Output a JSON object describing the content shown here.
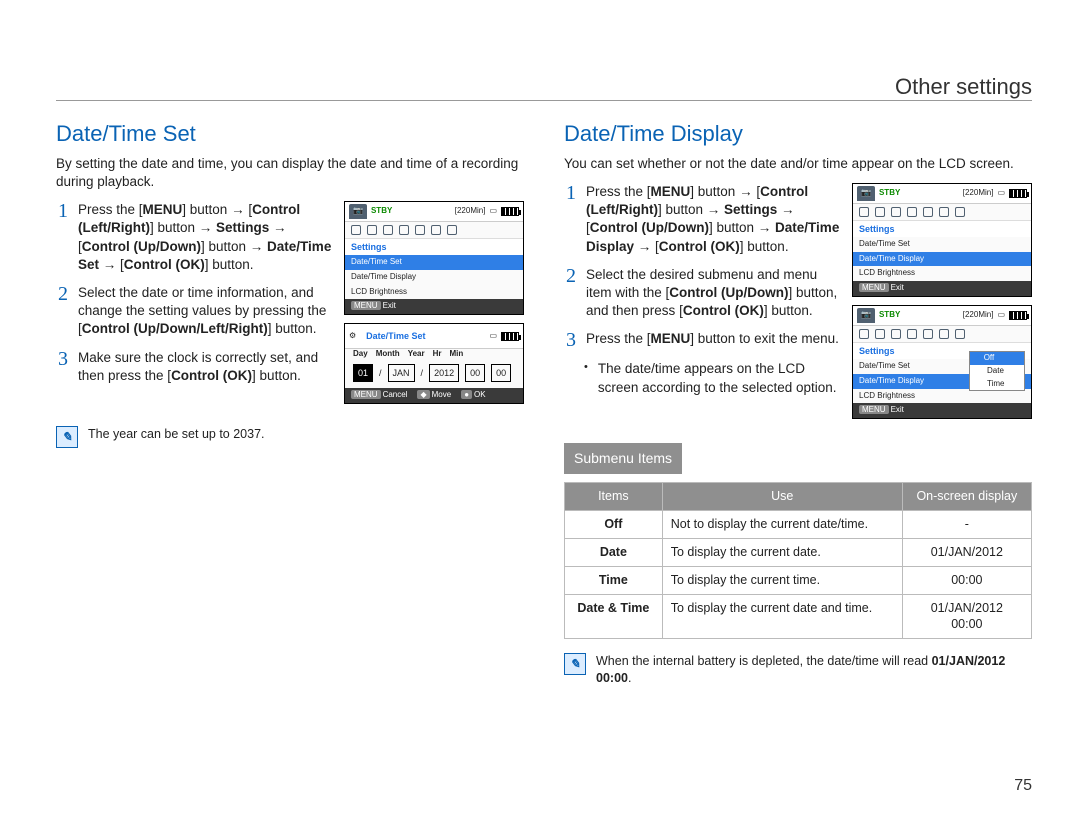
{
  "chapter_title": "Other settings",
  "page_number": "75",
  "left": {
    "heading": "Date/Time Set",
    "intro": "By setting the date and time, you can display the date and time of a recording during playback.",
    "steps": [
      {
        "n": "1",
        "html": "Press the [<b>MENU</b>] button → [<b>Control (Left/Right)</b>] button → <b>Settings</b> → [<b>Control (Up/Down)</b>] button → <b>Date/Time Set</b> → [<b>Control (OK)</b>] button."
      },
      {
        "n": "2",
        "html": "Select the date or time information, and change the setting values by pressing the [<b>Control (Up/Down/Left/Right)</b>] button."
      },
      {
        "n": "3",
        "html": "Make sure the clock is correctly set, and then press the [<b>Control (OK)</b>] button."
      }
    ],
    "note": "The year can be set up to 2037.",
    "lcd1": {
      "stby": "STBY",
      "time": "[220Min]",
      "heading": "Settings",
      "rows": [
        {
          "t": "Date/Time Set",
          "sel": true
        },
        {
          "t": "Date/Time Display"
        },
        {
          "t": "LCD Brightness"
        }
      ],
      "foot": {
        "menu": "MENU",
        "exit": "Exit"
      }
    },
    "lcd2": {
      "title": "Date/Time Set",
      "labels": [
        "Day",
        "Month",
        "Year",
        "Hr",
        "Min"
      ],
      "vals": [
        "01",
        "JAN",
        "2012",
        "00",
        "00"
      ],
      "foot": {
        "menu": "MENU",
        "cancel": "Cancel",
        "move": "Move",
        "ok": "OK"
      }
    }
  },
  "right": {
    "heading": "Date/Time Display",
    "intro": "You can set whether or not the date and/or time appear on the LCD screen.",
    "steps": [
      {
        "n": "1",
        "html": "Press the [<b>MENU</b>] button → [<b>Control (Left/Right)</b>] button → <b>Settings</b> → [<b>Control (Up/Down)</b>] button → <b>Date/Time Display</b> → [<b>Control (OK)</b>] button."
      },
      {
        "n": "2",
        "html": "Select the desired submenu and menu item with the [<b>Control (Up/Down)</b>] button, and then press [<b>Control (OK)</b>] button."
      },
      {
        "n": "3",
        "html": "Press the [<b>MENU</b>] button to exit the menu."
      }
    ],
    "bullet": "The date/time appears on the LCD screen according to the selected option.",
    "lcd1": {
      "stby": "STBY",
      "time": "[220Min]",
      "heading": "Settings",
      "rows": [
        {
          "t": "Date/Time Set"
        },
        {
          "t": "Date/Time Display",
          "sel": true
        },
        {
          "t": "LCD Brightness"
        }
      ],
      "foot": {
        "menu": "MENU",
        "exit": "Exit"
      }
    },
    "lcd2": {
      "stby": "STBY",
      "time": "[220Min]",
      "heading": "Settings",
      "rows": [
        {
          "t": "Date/Time Set"
        },
        {
          "t": "Date/Time Display",
          "sel": true
        },
        {
          "t": "LCD Brightness"
        }
      ],
      "popup": [
        {
          "t": "Off",
          "sel": true
        },
        {
          "t": "Date"
        },
        {
          "t": "Time"
        }
      ],
      "foot": {
        "menu": "MENU",
        "exit": "Exit"
      }
    },
    "submenu_header": "Submenu Items",
    "table": {
      "headers": [
        "Items",
        "Use",
        "On-screen display"
      ],
      "rows": [
        {
          "item": "Off",
          "use": "Not to display the current date/time.",
          "osd": "-"
        },
        {
          "item": "Date",
          "use": "To display the current date.",
          "osd": "01/JAN/2012"
        },
        {
          "item": "Time",
          "use": "To display the current time.",
          "osd": "00:00"
        },
        {
          "item": "Date & Time",
          "use": "To display the current date and time.",
          "osd": "01/JAN/2012\n00:00"
        }
      ]
    },
    "note_html": "When the internal battery is depleted, the date/time will read <b>01/JAN/2012 00:00</b>."
  }
}
